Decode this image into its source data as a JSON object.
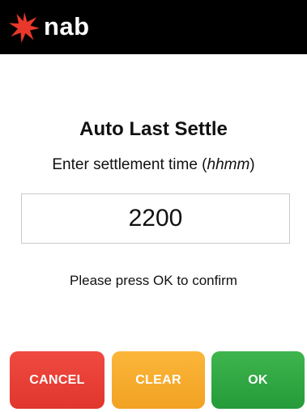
{
  "header": {
    "brand_text": "nab",
    "brand_star_color": "#e8382b",
    "background": "#000000"
  },
  "main": {
    "title": "Auto Last Settle",
    "prompt_prefix": "Enter settlement time (",
    "prompt_format": "hhmm",
    "prompt_suffix": ")",
    "time_value": "2200",
    "hint": "Please press OK to confirm"
  },
  "buttons": {
    "cancel_label": "CANCEL",
    "clear_label": "CLEAR",
    "ok_label": "OK",
    "cancel_color": "#e8402f",
    "clear_color": "#f6ab2b",
    "ok_color": "#2ea843"
  }
}
